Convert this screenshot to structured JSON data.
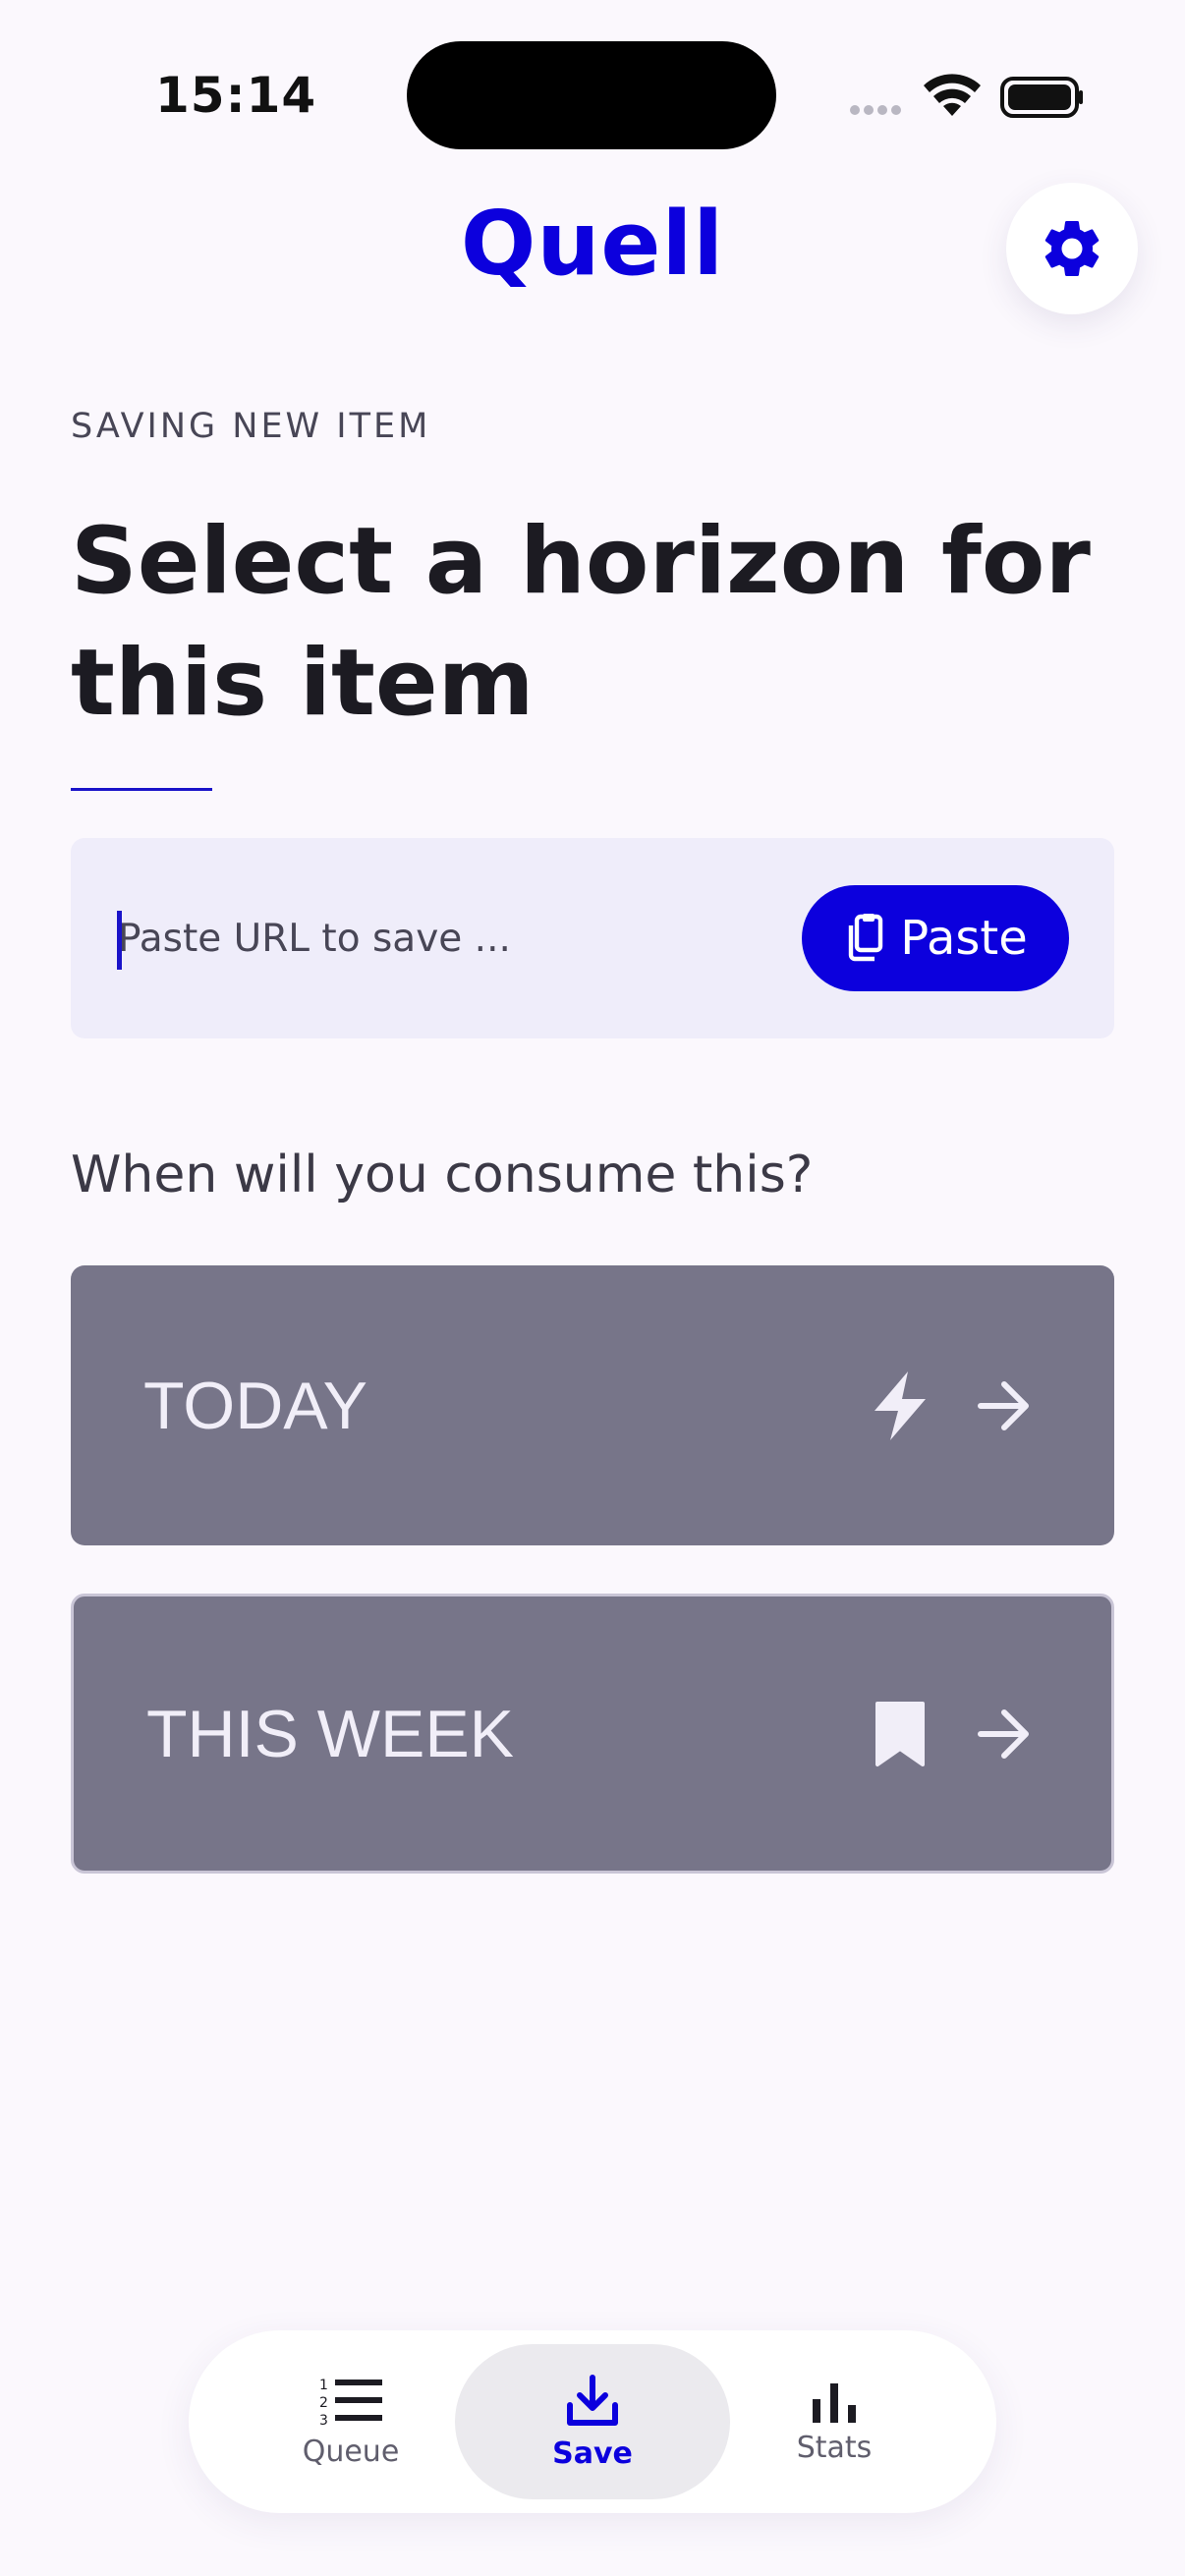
{
  "status_bar": {
    "time": "15:14"
  },
  "header": {
    "title": "Quell"
  },
  "form": {
    "eyebrow": "SAVING NEW ITEM",
    "heading": "Select a horizon for this item",
    "url_placeholder": "Paste URL to save ...",
    "url_value": "",
    "paste_label": "Paste",
    "question": "When will you consume this?"
  },
  "horizons": [
    {
      "label": "TODAY",
      "icon": "lightning-icon"
    },
    {
      "label": "THIS WEEK",
      "icon": "bookmark-icon"
    }
  ],
  "nav": {
    "items": [
      {
        "label": "Queue",
        "icon": "numbered-list-icon",
        "active": false
      },
      {
        "label": "Save",
        "icon": "download-icon",
        "active": true
      },
      {
        "label": "Stats",
        "icon": "bar-chart-icon",
        "active": false
      }
    ]
  },
  "colors": {
    "accent": "#0c00dd",
    "background": "#fbf8fd",
    "card": "#777589",
    "input_bg": "#efedfa"
  }
}
